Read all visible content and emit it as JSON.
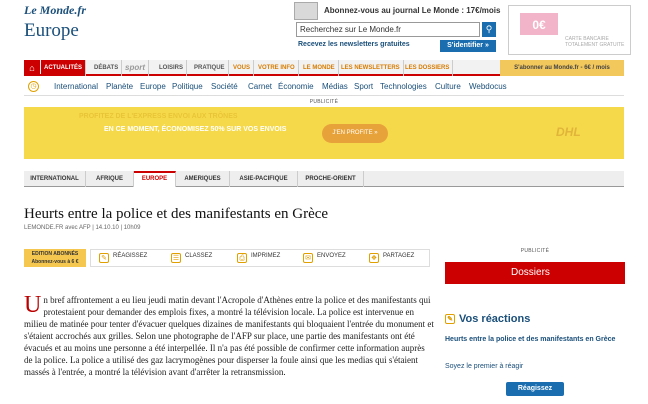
{
  "header": {
    "logo": "Le Monde.fr",
    "section": "Europe",
    "promo": "Abonnez-vous au journal Le Monde : 17€/mois",
    "search_placeholder": "Recherchez sur Le Monde.fr",
    "search_icon": "search-icon",
    "newsletters": "Recevez les newsletters gratuites",
    "identify": "S'identifier »",
    "ad_value": "0€",
    "ad_caption": "CARTE BANCAIRE TOTALEMENT GRATUITE"
  },
  "nav": {
    "home_icon": "home-icon",
    "items": [
      "Actualités",
      "Débats",
      "sport",
      "Loisirs",
      "Pratique",
      "Vous",
      "Votre info",
      "Le Monde",
      "Les newsletters",
      "Les dossiers"
    ],
    "subscribe": "S'abonner au Monde.fr - 6€ / mois"
  },
  "subnav": {
    "items": [
      "International",
      "Planète",
      "Europe",
      "Politique",
      "Société",
      "Carnet",
      "Économie",
      "Médias",
      "Sport",
      "Technologies",
      "Culture",
      "Webdocus"
    ]
  },
  "publicite_label": "PUBLICITÉ",
  "banner": {
    "line1": "PROFITEZ DE L'EXPRESS ENVOI AUX TRÔNES",
    "line2": "EN CE MOMENT, ÉCONOMISEZ 50% SUR VOS ENVOIS",
    "cta": "J'EN PROFITE »",
    "brand": "DHL"
  },
  "regions": [
    "INTERNATIONAL",
    "AFRIQUE",
    "EUROPE",
    "AMERIQUES",
    "ASIE-PACIFIQUE",
    "PROCHE-ORIENT"
  ],
  "article": {
    "title": "Heurts entre la police et des manifestants en Grèce",
    "meta": "LEMONDE.FR avec AFP | 14.10.10 | 10h09",
    "edition": "EDITION ABONNÉS Abonnez-vous à 6 €",
    "tools": [
      "RÉAGISSEZ",
      "CLASSEZ",
      "IMPRIMEZ",
      "ENVOYEZ",
      "PARTAGEZ"
    ],
    "dropcap": "U",
    "body": "n bref affrontement a eu lieu jeudi matin devant l'Acropole d'Athènes entre la police et des manifestants qui protestaient pour demander des emplois fixes, a montré la télévision locale. La police est intervenue en milieu de matinée pour tenter d'évacuer quelques dizaines de manifestants qui bloquaient l'entrée du monument et s'étaient accrochés aux grilles. Selon une photographe de l'AFP sur place, une partie des manifestants ont été évacués et au moins une personne a été interpellée. Il n'a pas été possible de confirmer cette information auprès de la police. La police a utilisé des gaz lacrymogènes pour disperser la foule ainsi que les medias qui s'étaient massés à l'entrée, a montré la télévision avant d'arrêter la retransmission."
  },
  "sidebar": {
    "dossiers": "Dossiers",
    "reactions_title": "Vos réactions",
    "reaction_article": "Heurts entre la police et des manifestants en Grèce",
    "first": "Soyez le premier à réagir",
    "react_btn": "Réagissez"
  }
}
